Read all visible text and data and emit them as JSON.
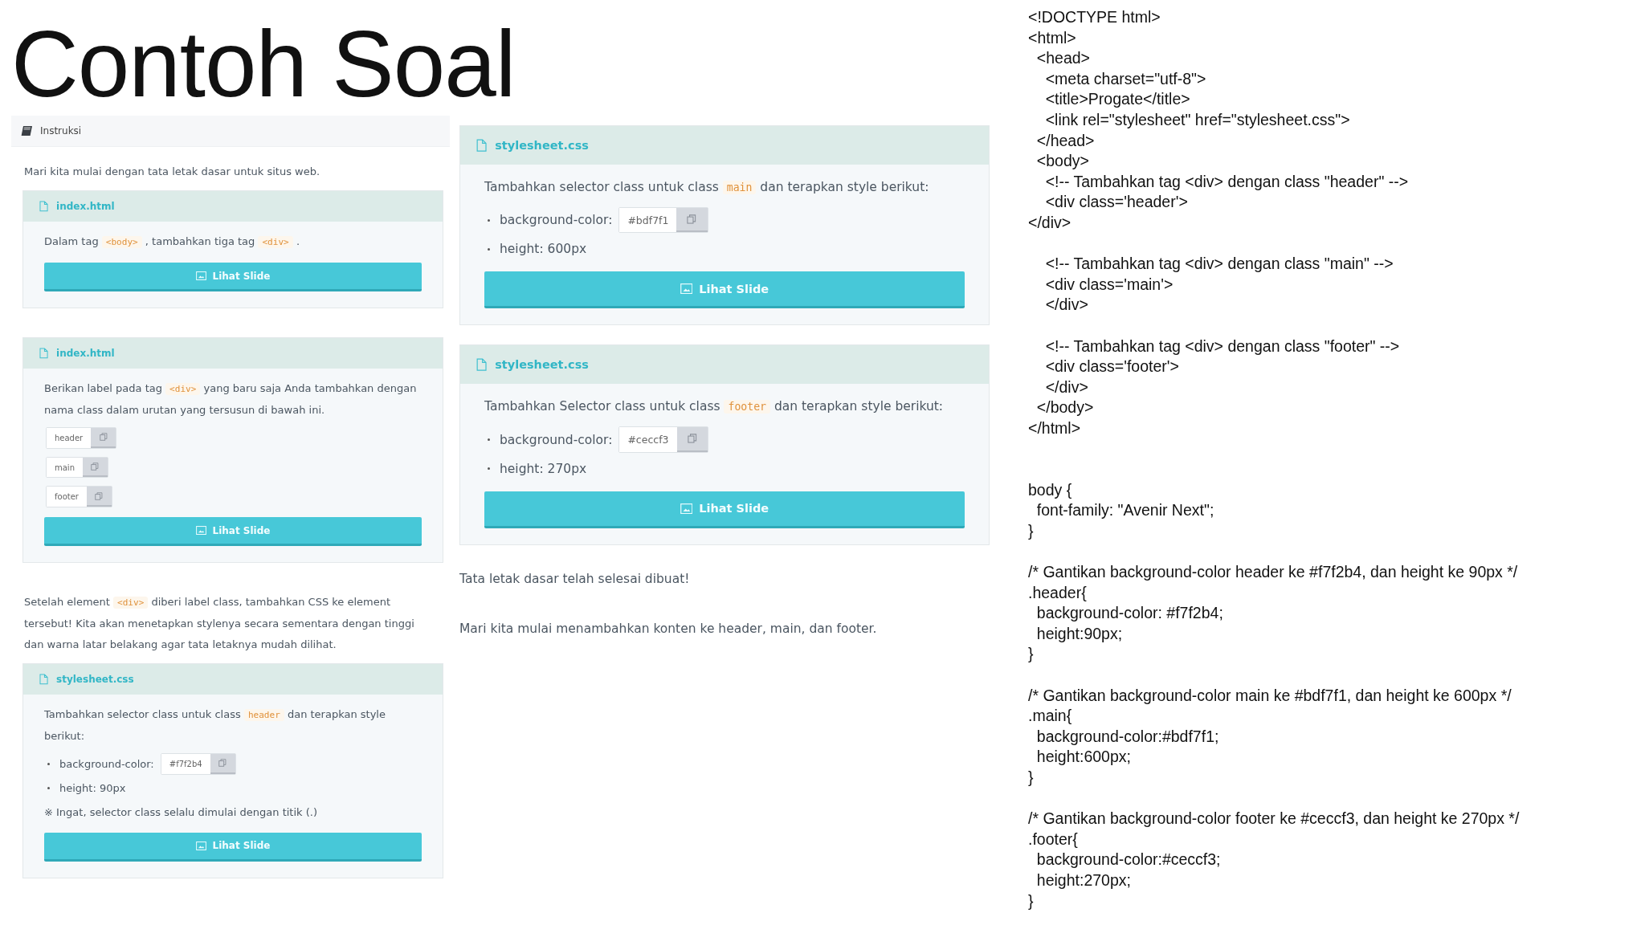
{
  "title": "Contoh Soal",
  "left_panel": {
    "header": "Instruksi",
    "items": [
      {
        "kind": "paragraph",
        "parts": [
          {
            "text": "Mari kita mulai dengan tata letak dasar untuk situs web.",
            "code": false
          }
        ]
      },
      {
        "kind": "card",
        "file": "index.html",
        "button": "Lihat Slide",
        "content": [
          {
            "kind": "text",
            "parts": [
              {
                "text": "Dalam tag",
                "code": false
              },
              {
                "text": "<body>",
                "code": true
              },
              {
                "text": ", tambahkan tiga tag",
                "code": false
              },
              {
                "text": "<div>",
                "code": true
              },
              {
                "text": ".",
                "code": false
              }
            ]
          }
        ]
      },
      {
        "kind": "card",
        "file": "index.html",
        "button": "Lihat Slide",
        "content": [
          {
            "kind": "text",
            "parts": [
              {
                "text": "Berikan label pada tag",
                "code": false
              },
              {
                "text": "<div>",
                "code": true
              },
              {
                "text": "yang baru saja Anda tambahkan dengan nama class dalam urutan yang tersusun di bawah ini.",
                "code": false
              }
            ]
          },
          {
            "kind": "copy",
            "value": "header"
          },
          {
            "kind": "copy",
            "value": "main"
          },
          {
            "kind": "copy",
            "value": "footer"
          }
        ]
      },
      {
        "kind": "paragraph",
        "parts": [
          {
            "text": "Setelah element",
            "code": false
          },
          {
            "text": "<div>",
            "code": true
          },
          {
            "text": "diberi label class, tambahkan CSS ke element tersebut! Kita akan menetapkan stylenya secara sementara dengan tinggi dan warna latar belakang agar tata letaknya mudah dilihat.",
            "code": false
          }
        ]
      },
      {
        "kind": "card",
        "file": "stylesheet.css",
        "button": "Lihat Slide",
        "content": [
          {
            "kind": "text",
            "parts": [
              {
                "text": "Tambahkan selector class untuk class",
                "code": false
              },
              {
                "text": "header",
                "code": true
              },
              {
                "text": "dan terapkan style berikut:",
                "code": false
              }
            ]
          },
          {
            "kind": "bullet_copy",
            "label": "background-color:",
            "value": "#f7f2b4"
          },
          {
            "kind": "bullet",
            "text": "height: 90px"
          },
          {
            "kind": "note",
            "text": "※ Ingat, selector class selalu dimulai dengan titik (.)"
          }
        ]
      }
    ]
  },
  "middle_panel": {
    "items": [
      {
        "kind": "card",
        "file": "stylesheet.css",
        "button": "Lihat Slide",
        "content": [
          {
            "kind": "text",
            "parts": [
              {
                "text": "Tambahkan selector class untuk class",
                "code": false
              },
              {
                "text": "main",
                "code": true
              },
              {
                "text": "dan terapkan style berikut:",
                "code": false
              }
            ]
          },
          {
            "kind": "bullet_copy",
            "label": "background-color:",
            "value": "#bdf7f1"
          },
          {
            "kind": "bullet",
            "text": "height: 600px"
          }
        ]
      },
      {
        "kind": "card",
        "file": "stylesheet.css",
        "button": "Lihat Slide",
        "content": [
          {
            "kind": "text",
            "parts": [
              {
                "text": "Tambahkan Selector class untuk class",
                "code": false
              },
              {
                "text": "footer",
                "code": true
              },
              {
                "text": "dan terapkan style berikut:",
                "code": false
              }
            ]
          },
          {
            "kind": "bullet_copy",
            "label": "background-color:",
            "value": "#ceccf3"
          },
          {
            "kind": "bullet",
            "text": "height: 270px"
          }
        ]
      },
      {
        "kind": "paragraph",
        "parts": [
          {
            "text": "Tata letak dasar telah selesai dibuat!",
            "code": false
          }
        ]
      },
      {
        "kind": "paragraph",
        "parts": [
          {
            "text": "Mari kita mulai menambahkan konten ke header, main, dan footer.",
            "code": false
          }
        ]
      }
    ]
  },
  "code": {
    "html": [
      [
        "<!DOCTYPE html>",
        "<html>",
        "  <head>",
        "    <meta charset=\"utf-8\">",
        "    <title>Progate</title>",
        "    <link rel=\"stylesheet\" href=\"stylesheet.css\">",
        "  </head>",
        "  <body>",
        "    <!-- Tambahkan tag <div> dengan class \"header\" -->",
        "    <div class='header'>",
        "</div>"
      ],
      [
        "    <!-- Tambahkan tag <div> dengan class \"main\" -->",
        "    <div class='main'>",
        "    </div>"
      ],
      [
        "    <!-- Tambahkan tag <div> dengan class \"footer\" -->",
        "    <div class='footer'>",
        "    </div>",
        "  </body>",
        "</html>"
      ]
    ],
    "css": [
      [
        "body {",
        "  font-family: \"Avenir Next\";",
        "}"
      ],
      [
        "/* Gantikan background-color header ke #f7f2b4, dan height ke 90px */",
        ".header{",
        "  background-color: #f7f2b4;",
        "  height:90px;",
        "}"
      ],
      [
        "/* Gantikan background-color main ke #bdf7f1, dan height ke 600px */",
        ".main{",
        "  background-color:#bdf7f1;",
        "  height:600px;",
        "}"
      ],
      [
        "/* Gantikan background-color footer ke #ceccf3, dan height ke 270px */",
        ".footer{",
        "  background-color:#ceccf3;",
        "  height:270px;",
        "}"
      ]
    ]
  }
}
